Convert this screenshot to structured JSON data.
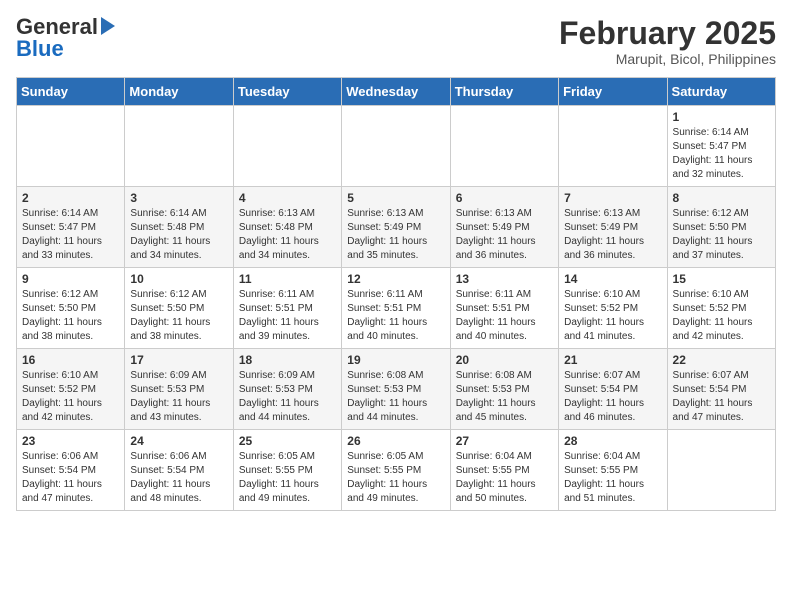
{
  "header": {
    "logo_general": "General",
    "logo_blue": "Blue",
    "month_year": "February 2025",
    "location": "Marupit, Bicol, Philippines"
  },
  "calendar": {
    "days_of_week": [
      "Sunday",
      "Monday",
      "Tuesday",
      "Wednesday",
      "Thursday",
      "Friday",
      "Saturday"
    ],
    "weeks": [
      [
        {
          "date": "",
          "info": ""
        },
        {
          "date": "",
          "info": ""
        },
        {
          "date": "",
          "info": ""
        },
        {
          "date": "",
          "info": ""
        },
        {
          "date": "",
          "info": ""
        },
        {
          "date": "",
          "info": ""
        },
        {
          "date": "1",
          "info": "Sunrise: 6:14 AM\nSunset: 5:47 PM\nDaylight: 11 hours and 32 minutes."
        }
      ],
      [
        {
          "date": "2",
          "info": "Sunrise: 6:14 AM\nSunset: 5:47 PM\nDaylight: 11 hours and 33 minutes."
        },
        {
          "date": "3",
          "info": "Sunrise: 6:14 AM\nSunset: 5:48 PM\nDaylight: 11 hours and 34 minutes."
        },
        {
          "date": "4",
          "info": "Sunrise: 6:13 AM\nSunset: 5:48 PM\nDaylight: 11 hours and 34 minutes."
        },
        {
          "date": "5",
          "info": "Sunrise: 6:13 AM\nSunset: 5:49 PM\nDaylight: 11 hours and 35 minutes."
        },
        {
          "date": "6",
          "info": "Sunrise: 6:13 AM\nSunset: 5:49 PM\nDaylight: 11 hours and 36 minutes."
        },
        {
          "date": "7",
          "info": "Sunrise: 6:13 AM\nSunset: 5:49 PM\nDaylight: 11 hours and 36 minutes."
        },
        {
          "date": "8",
          "info": "Sunrise: 6:12 AM\nSunset: 5:50 PM\nDaylight: 11 hours and 37 minutes."
        }
      ],
      [
        {
          "date": "9",
          "info": "Sunrise: 6:12 AM\nSunset: 5:50 PM\nDaylight: 11 hours and 38 minutes."
        },
        {
          "date": "10",
          "info": "Sunrise: 6:12 AM\nSunset: 5:50 PM\nDaylight: 11 hours and 38 minutes."
        },
        {
          "date": "11",
          "info": "Sunrise: 6:11 AM\nSunset: 5:51 PM\nDaylight: 11 hours and 39 minutes."
        },
        {
          "date": "12",
          "info": "Sunrise: 6:11 AM\nSunset: 5:51 PM\nDaylight: 11 hours and 40 minutes."
        },
        {
          "date": "13",
          "info": "Sunrise: 6:11 AM\nSunset: 5:51 PM\nDaylight: 11 hours and 40 minutes."
        },
        {
          "date": "14",
          "info": "Sunrise: 6:10 AM\nSunset: 5:52 PM\nDaylight: 11 hours and 41 minutes."
        },
        {
          "date": "15",
          "info": "Sunrise: 6:10 AM\nSunset: 5:52 PM\nDaylight: 11 hours and 42 minutes."
        }
      ],
      [
        {
          "date": "16",
          "info": "Sunrise: 6:10 AM\nSunset: 5:52 PM\nDaylight: 11 hours and 42 minutes."
        },
        {
          "date": "17",
          "info": "Sunrise: 6:09 AM\nSunset: 5:53 PM\nDaylight: 11 hours and 43 minutes."
        },
        {
          "date": "18",
          "info": "Sunrise: 6:09 AM\nSunset: 5:53 PM\nDaylight: 11 hours and 44 minutes."
        },
        {
          "date": "19",
          "info": "Sunrise: 6:08 AM\nSunset: 5:53 PM\nDaylight: 11 hours and 44 minutes."
        },
        {
          "date": "20",
          "info": "Sunrise: 6:08 AM\nSunset: 5:53 PM\nDaylight: 11 hours and 45 minutes."
        },
        {
          "date": "21",
          "info": "Sunrise: 6:07 AM\nSunset: 5:54 PM\nDaylight: 11 hours and 46 minutes."
        },
        {
          "date": "22",
          "info": "Sunrise: 6:07 AM\nSunset: 5:54 PM\nDaylight: 11 hours and 47 minutes."
        }
      ],
      [
        {
          "date": "23",
          "info": "Sunrise: 6:06 AM\nSunset: 5:54 PM\nDaylight: 11 hours and 47 minutes."
        },
        {
          "date": "24",
          "info": "Sunrise: 6:06 AM\nSunset: 5:54 PM\nDaylight: 11 hours and 48 minutes."
        },
        {
          "date": "25",
          "info": "Sunrise: 6:05 AM\nSunset: 5:55 PM\nDaylight: 11 hours and 49 minutes."
        },
        {
          "date": "26",
          "info": "Sunrise: 6:05 AM\nSunset: 5:55 PM\nDaylight: 11 hours and 49 minutes."
        },
        {
          "date": "27",
          "info": "Sunrise: 6:04 AM\nSunset: 5:55 PM\nDaylight: 11 hours and 50 minutes."
        },
        {
          "date": "28",
          "info": "Sunrise: 6:04 AM\nSunset: 5:55 PM\nDaylight: 11 hours and 51 minutes."
        },
        {
          "date": "",
          "info": ""
        }
      ]
    ]
  }
}
